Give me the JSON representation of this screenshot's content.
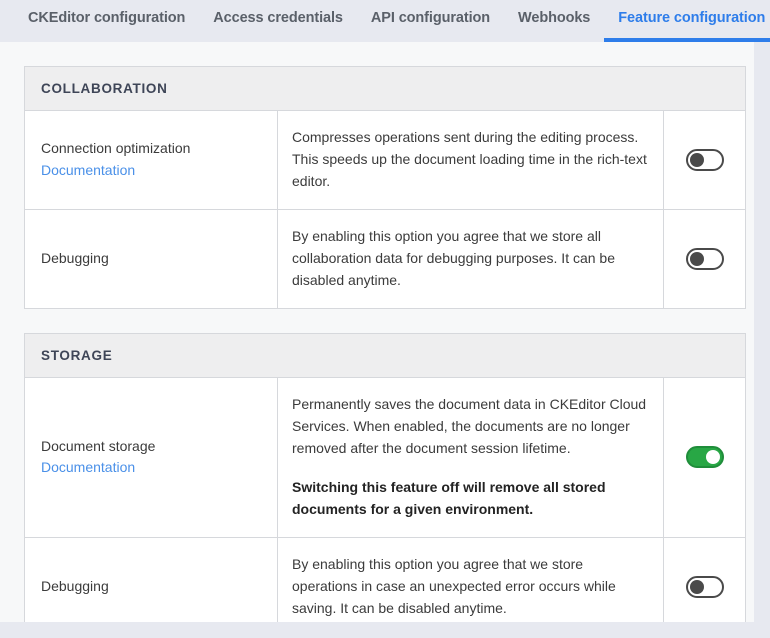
{
  "tabs": [
    {
      "label": "CKEditor configuration",
      "active": false
    },
    {
      "label": "Access credentials",
      "active": false
    },
    {
      "label": "API configuration",
      "active": false
    },
    {
      "label": "Webhooks",
      "active": false
    },
    {
      "label": "Feature configuration",
      "active": true
    }
  ],
  "colors": {
    "page_background": "#e7e9f0",
    "panel_background": "#f7f8f9",
    "card_background": "#ffffff",
    "card_border": "#d6d8dc",
    "section_header_background": "#eeeeef",
    "section_header_text": "#3e4557",
    "accent_blue": "#2e7dea",
    "link_blue": "#4a90e8",
    "toggle_on_green": "#28a745",
    "toggle_off_gray": "#4a4a4a"
  },
  "sections": [
    {
      "title": "Collaboration",
      "rows": [
        {
          "name": "Connection optimization",
          "doc_link": "Documentation",
          "description": "Compresses operations sent during the editing process. This speeds up the document loading time in the rich-text editor.",
          "emphasis": "",
          "toggle_state": "off"
        },
        {
          "name": "Debugging",
          "doc_link": "",
          "description": "By enabling this option you agree that we store all collaboration data for debugging purposes. It can be disabled anytime.",
          "emphasis": "",
          "toggle_state": "off"
        }
      ]
    },
    {
      "title": "Storage",
      "rows": [
        {
          "name": "Document storage",
          "doc_link": "Documentation",
          "description": "Permanently saves the document data in CKEditor Cloud Services. When enabled, the documents are no longer removed after the document session lifetime.",
          "emphasis": "Switching this feature off will remove all stored documents for a given environment.",
          "toggle_state": "on"
        },
        {
          "name": "Debugging",
          "doc_link": "",
          "description": "By enabling this option you agree that we store operations in case an unexpected error occurs while saving. It can be disabled anytime.",
          "emphasis": "",
          "toggle_state": "off"
        }
      ]
    }
  ]
}
